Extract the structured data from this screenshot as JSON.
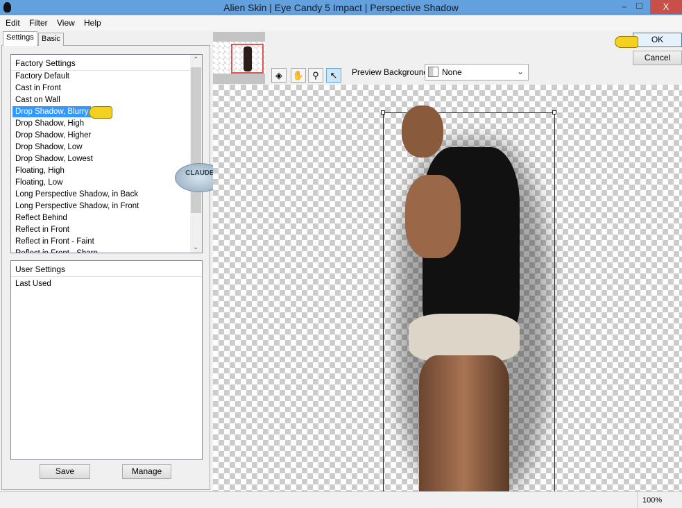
{
  "window": {
    "title": "Alien Skin | Eye Candy 5 Impact | Perspective Shadow",
    "close": "X",
    "minimize": "–",
    "maximize": "☐"
  },
  "menu": [
    "Edit",
    "Filter",
    "View",
    "Help"
  ],
  "tabs": [
    "Settings",
    "Basic"
  ],
  "factory": {
    "header": "Factory Settings",
    "items": [
      "Factory Default",
      "Cast in Front",
      "Cast on Wall",
      "Drop Shadow, Blurry",
      "Drop Shadow, High",
      "Drop Shadow, Higher",
      "Drop Shadow, Low",
      "Drop Shadow, Lowest",
      "Floating, High",
      "Floating, Low",
      "Long Perspective Shadow, in Back",
      "Long Perspective Shadow, in Front",
      "Reflect Behind",
      "Reflect in Front",
      "Reflect in Front - Faint",
      "Reflect in Front - Sharp"
    ],
    "selected": "Drop Shadow, Blurry"
  },
  "user": {
    "header": "User Settings",
    "items": [
      "Last Used"
    ]
  },
  "buttons": {
    "save": "Save",
    "manage": "Manage",
    "ok": "OK",
    "cancel": "Cancel"
  },
  "preview_bg": {
    "label": "Preview Background:",
    "value": "None"
  },
  "watermark": "CLAUDE",
  "status": {
    "zoom": "100%"
  }
}
